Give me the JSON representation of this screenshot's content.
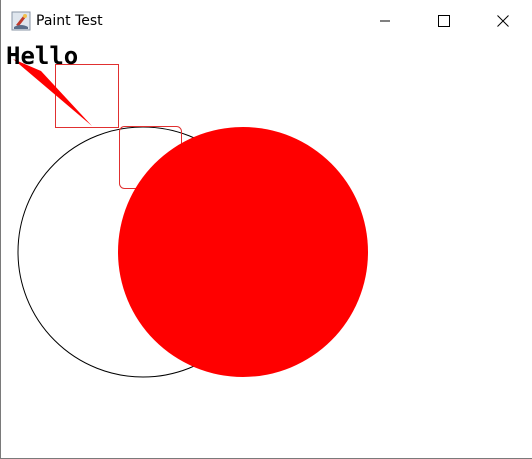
{
  "window": {
    "title": "Paint Test",
    "app_icon": "java-coffee-cup-icon",
    "controls": {
      "minimize_icon": "minimize-icon",
      "maximize_icon": "maximize-icon",
      "close_icon": "close-icon"
    }
  },
  "canvas": {
    "greeting_text": "Hello",
    "colors": {
      "red": "#ff0000",
      "outline_red": "#e03030",
      "black": "#000000"
    }
  }
}
